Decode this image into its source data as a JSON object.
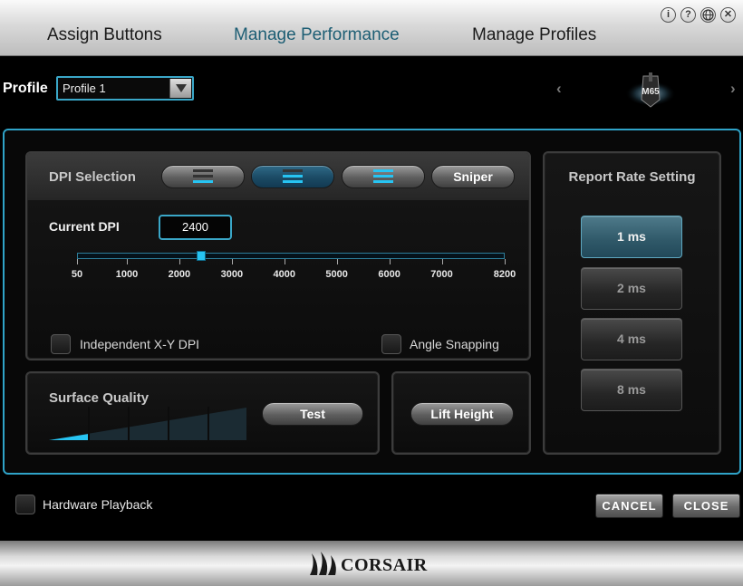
{
  "tabs": [
    {
      "label": "Assign Buttons",
      "active": false
    },
    {
      "label": "Manage Performance",
      "active": true
    },
    {
      "label": "Manage Profiles",
      "active": false
    }
  ],
  "window_controls": [
    "info-icon",
    "help-icon",
    "globe-icon",
    "close-icon"
  ],
  "profile": {
    "label": "Profile",
    "selected": "Profile 1"
  },
  "device": {
    "name": "M65"
  },
  "dpi": {
    "title": "DPI Selection",
    "stages": [
      {
        "name": "stage-1",
        "label": "",
        "level": 1,
        "selected": false
      },
      {
        "name": "stage-2",
        "label": "",
        "level": 2,
        "selected": true
      },
      {
        "name": "stage-3",
        "label": "",
        "level": 3,
        "selected": false
      },
      {
        "name": "sniper",
        "label": "Sniper",
        "selected": false
      }
    ],
    "current_label": "Current DPI",
    "current_value": "2400",
    "slider_value": 2400,
    "ticks": [
      "50",
      "1000",
      "2000",
      "3000",
      "4000",
      "5000",
      "6000",
      "7000",
      "8200"
    ],
    "independent_xy_label": "Independent X-Y DPI",
    "independent_xy_checked": false,
    "angle_snapping_label": "Angle Snapping",
    "angle_snapping_checked": false
  },
  "report_rate": {
    "title": "Report Rate Setting",
    "options": [
      "1 ms",
      "2 ms",
      "4 ms",
      "8 ms"
    ],
    "selected": "1 ms"
  },
  "surface_quality": {
    "title": "Surface Quality",
    "level": 1,
    "segments": 5,
    "test_label": "Test"
  },
  "lift_height": {
    "label": "Lift Height"
  },
  "hardware_playback": {
    "label": "Hardware Playback",
    "checked": false
  },
  "buttons": {
    "cancel": "CANCEL",
    "close": "CLOSE"
  },
  "brand": "CORSAIR",
  "colors": {
    "accent": "#2fa3c8",
    "active_tab": "#1d5e74",
    "indicator": "#27c4f2"
  }
}
